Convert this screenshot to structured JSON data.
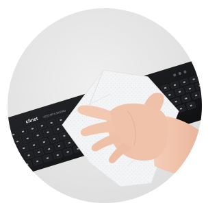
{
  "image": {
    "subject": "hand-wiping-keyboard-with-wet-wipe",
    "keyboard_brand": "clinet",
    "keyboard_model_text": "VESTARYLBOARD",
    "colors": {
      "background_outer": "#ffffff",
      "background_circle": "#e8e8e8",
      "keyboard_body": "#17181a",
      "key_cap": "#1f2023",
      "key_legend": "#cfd3d8",
      "wipe": "#f4f5f6",
      "skin": "#f2c4ad"
    }
  }
}
